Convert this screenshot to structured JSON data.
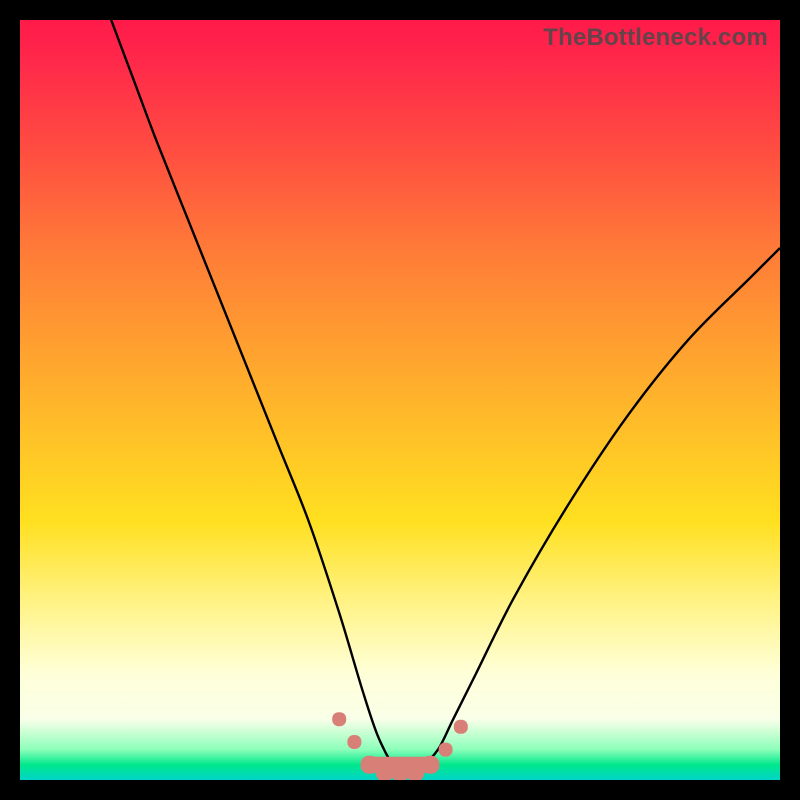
{
  "watermark": "TheBottleneck.com",
  "chart_data": {
    "type": "line",
    "title": "",
    "xlabel": "",
    "ylabel": "",
    "xlim": [
      0,
      100
    ],
    "ylim": [
      0,
      100
    ],
    "series": [
      {
        "name": "bottleneck-curve",
        "x": [
          12,
          15,
          18,
          22,
          26,
          30,
          34,
          38,
          42,
          45,
          47,
          49,
          50,
          51,
          53,
          55,
          57,
          60,
          65,
          72,
          80,
          88,
          96,
          100
        ],
        "values": [
          100,
          92,
          84,
          74,
          64,
          54,
          44,
          34,
          22,
          12,
          6,
          2,
          1,
          1,
          2,
          4,
          8,
          14,
          24,
          36,
          48,
          58,
          66,
          70
        ]
      }
    ],
    "markers": {
      "name": "highlight-points",
      "color": "#d88078",
      "x": [
        42,
        44,
        46,
        48,
        50,
        52,
        54,
        56,
        58
      ],
      "values": [
        8,
        5,
        2,
        1,
        1,
        1,
        2,
        4,
        7
      ]
    }
  }
}
